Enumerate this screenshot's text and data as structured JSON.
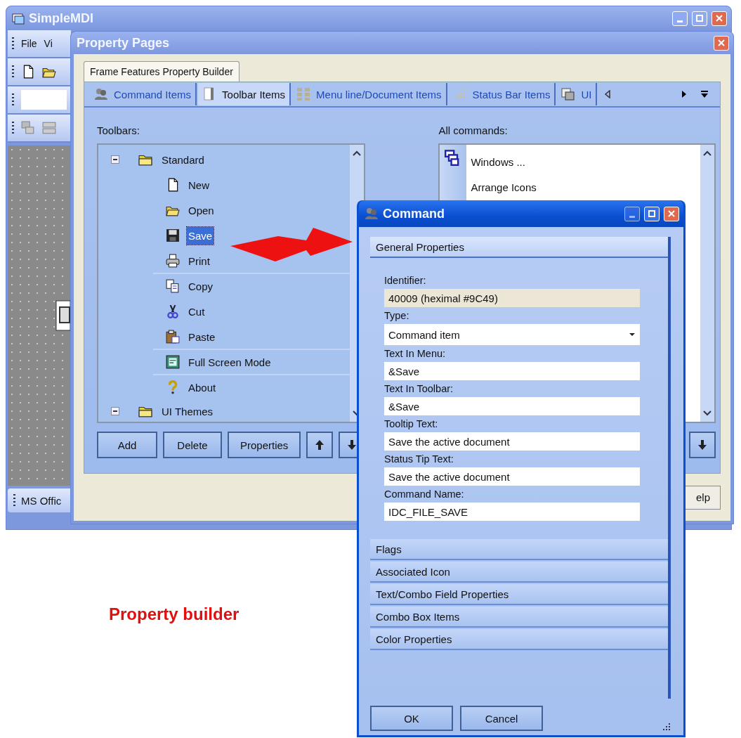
{
  "main_window": {
    "title": "SimpleMDI",
    "menu": [
      "File",
      "Vi"
    ],
    "bottom_tab": "MS Offic"
  },
  "property_pages": {
    "title": "Property Pages",
    "outer_tabs": [
      {
        "label": "Frame Features Property Builder",
        "selected": true
      }
    ],
    "tabs": [
      {
        "label": "Command Items",
        "selected": false
      },
      {
        "label": "Toolbar Items",
        "selected": true
      },
      {
        "label": "Menu line/Document Items",
        "selected": false
      },
      {
        "label": "Status Bar Items",
        "selected": false
      },
      {
        "label": "UI",
        "selected": false
      }
    ],
    "toolbars": {
      "label": "Toolbars:",
      "tree": [
        {
          "label": "Standard",
          "expanded": true,
          "children": [
            {
              "label": "New",
              "selected": false,
              "separator_before": false
            },
            {
              "label": "Open",
              "selected": false,
              "separator_before": false
            },
            {
              "label": "Save",
              "selected": true,
              "separator_before": false
            },
            {
              "label": "Print",
              "selected": false,
              "separator_before": false
            },
            {
              "label": "Copy",
              "selected": false,
              "separator_before": true
            },
            {
              "label": "Cut",
              "selected": false,
              "separator_before": false
            },
            {
              "label": "Paste",
              "selected": false,
              "separator_before": false
            },
            {
              "label": "Full Screen Mode",
              "selected": false,
              "separator_before": true
            },
            {
              "label": "About",
              "selected": false,
              "separator_before": true
            }
          ]
        },
        {
          "label": "UI Themes",
          "expanded": true
        }
      ]
    },
    "buttons": [
      "Add",
      "Delete",
      "Properties"
    ],
    "all_commands": {
      "label": "All commands:",
      "items": [
        "Windows ...",
        "Arrange Icons"
      ]
    },
    "help_button": "elp"
  },
  "command_dialog": {
    "title": "Command",
    "sections": [
      {
        "title": "General Properties",
        "expanded": true,
        "fields": [
          {
            "label": "Identifier:",
            "value": "40009 (heximal #9C49)",
            "kind": "readonly"
          },
          {
            "label": "Type:",
            "value": "Command item",
            "kind": "dropdown"
          },
          {
            "label": "Text In Menu:",
            "value": "&Save",
            "kind": "text"
          },
          {
            "label": "Text In Toolbar:",
            "value": "&Save",
            "kind": "text"
          },
          {
            "label": "Tooltip Text:",
            "value": "Save the active document",
            "kind": "text"
          },
          {
            "label": "Status Tip Text:",
            "value": "Save the active document",
            "kind": "text"
          },
          {
            "label": "Command Name:",
            "value": "IDC_FILE_SAVE",
            "kind": "text"
          }
        ]
      },
      {
        "title": "Flags",
        "expanded": false
      },
      {
        "title": "Associated Icon",
        "expanded": false
      },
      {
        "title": "Text/Combo Field Properties",
        "expanded": false
      },
      {
        "title": "Combo Box Items",
        "expanded": false
      },
      {
        "title": "Color Properties",
        "expanded": false
      }
    ],
    "buttons": [
      "OK",
      "Cancel"
    ]
  },
  "caption": "Property builder"
}
